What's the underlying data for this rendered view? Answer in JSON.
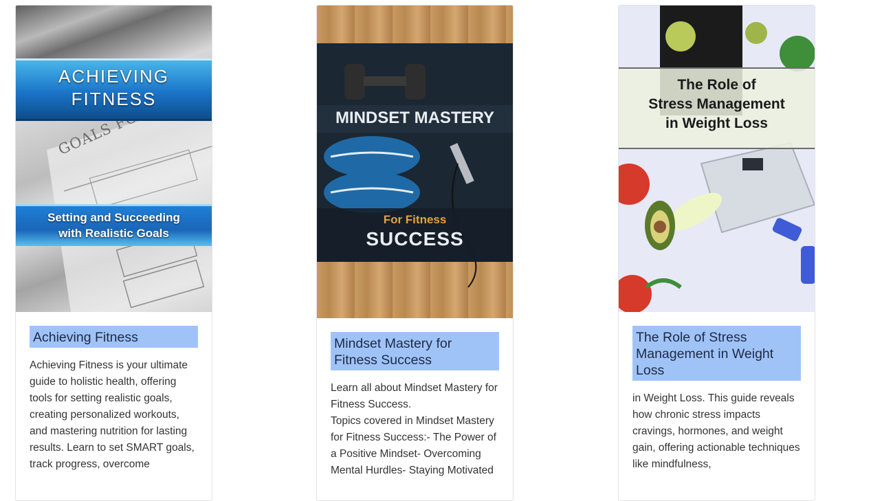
{
  "cards": [
    {
      "cover": {
        "heading_lines": [
          "Achieving",
          "Fitness"
        ],
        "paper_text": "GOALS FOR TH",
        "subtitle_lines": [
          "Setting and Succeeding",
          "with Realistic Goals"
        ]
      },
      "title": "Achieving Fitness",
      "description": [
        "Achieving Fitness is your ultimate guide to holistic health, offering tools for setting realistic goals, creating personalized workouts, and mastering nutrition for lasting results. Learn to set SMART goals, track progress, overcome"
      ]
    },
    {
      "cover": {
        "heading_lines": [
          "MINDSET MASTERY"
        ],
        "subtitle_lines": [
          "For Fitness",
          "SUCCESS"
        ]
      },
      "title": "Mindset Mastery for Fitness Success",
      "description": [
        "Learn all about Mindset Mastery for Fitness Success.",
        "Topics covered in Mindset Mastery for Fitness Success:- The Power of a Positive Mindset- Overcoming Mental Hurdles- Staying Motivated"
      ]
    },
    {
      "cover": {
        "heading_lines": [
          "The Role of",
          "Stress Management",
          "in Weight Loss"
        ]
      },
      "title": "The Role of Stress Management in Weight Loss",
      "description": [
        "in Weight Loss. This guide reveals how chronic stress impacts cravings, hormones, and weight gain, offering actionable techniques like mindfulness,"
      ]
    }
  ],
  "colors": {
    "title_bg": "#a0c3f7",
    "banner_blue": "#1f7fd6",
    "mindset_accent": "#e6a23c"
  }
}
